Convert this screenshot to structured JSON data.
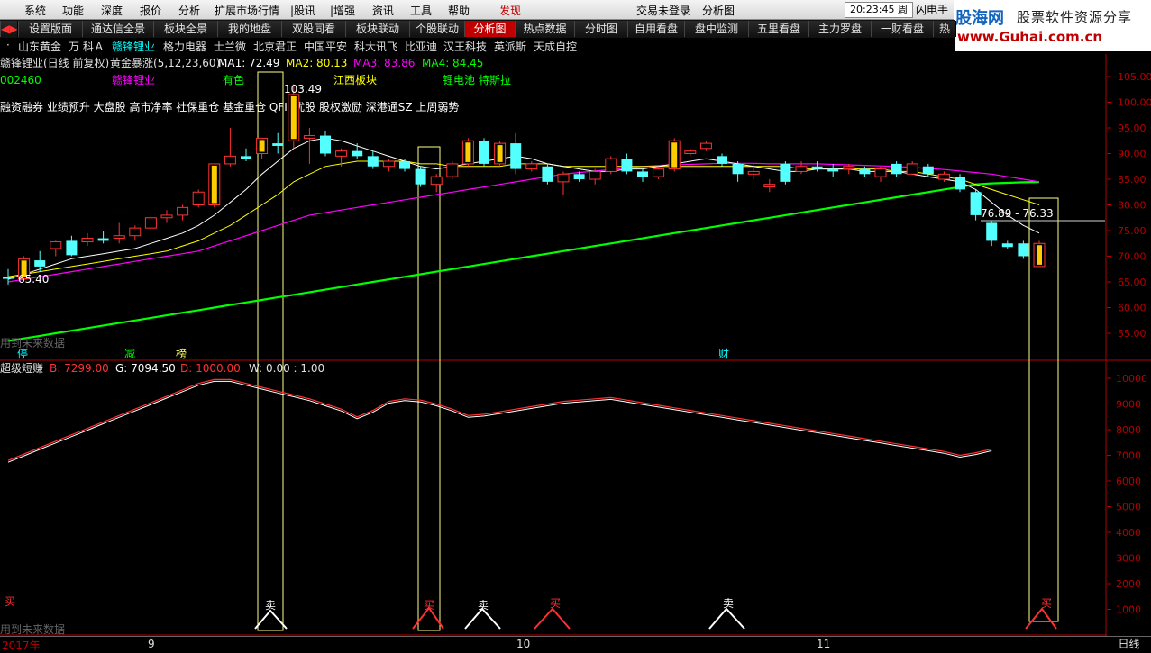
{
  "menu": {
    "items": [
      "系统",
      "功能",
      "深度",
      "报价",
      "分析",
      "扩展市场行情",
      "|股讯",
      "|增强",
      "资讯",
      "工具",
      "帮助",
      "发现"
    ],
    "center": [
      "交易未登录",
      "分析图"
    ],
    "clock": "20:23:45 周一",
    "flash": "闪电手"
  },
  "logo": {
    "line1": "股海网",
    "line2": "股票软件资源分享",
    "line3": "www.Guhai.com.cn"
  },
  "tabs": [
    "设置版面",
    "通达信全景",
    "板块全景",
    "我的地盘",
    "双股同看",
    "板块联动",
    "个股联动",
    "分析图",
    "热点数据",
    "分时图",
    "自用看盘",
    "盘中监测",
    "五里看盘",
    "主力罗盘",
    "一财看盘",
    "热"
  ],
  "active_tab": "分析图",
  "stocks": [
    "山东黄金",
    "万 科Ａ",
    "赣锋锂业",
    "格力电器",
    "士兰微",
    "北京君正",
    "中国平安",
    "科大讯飞",
    "比亚迪",
    "汉王科技",
    "英派斯",
    "天成自控"
  ],
  "active_stock": "赣锋锂业",
  "colors": {
    "up": "#ff3232",
    "down": "#54ffff",
    "ma1": "#ffffff",
    "ma2": "#ffff00",
    "ma3": "#ff00ff",
    "ma4": "#00ff00",
    "bg": "#000000",
    "grid": "#b40000"
  },
  "main": {
    "header": {
      "title": "赣锋锂业(日线 前复权)",
      "indicator": "黄金暴涨(5,12,23,60)",
      "ma1": "MA1: 72.49",
      "ma2": "MA2: 80.13",
      "ma3": "MA3: 83.86",
      "ma4": "MA4: 84.45"
    },
    "code": "002460",
    "name": "赣锋锂业",
    "sector1": "有色",
    "sector2": "江西板块",
    "concept": "锂电池 特斯拉",
    "tags": "融资融券 业绩预升 大盘股 高市净率 社保重仓 基金重仓 QFII 优股 股权激励 深港通SZ 上周弱势",
    "high_label": "103.49",
    "low_label": "65.40",
    "range_label": "76.89 - 76.33",
    "bottom_note": "用到未来数据",
    "markers": [
      "停",
      "减",
      "榜",
      "财"
    ]
  },
  "sub": {
    "header": {
      "name": "超级短赚",
      "b": "B: 7299.00",
      "g": "G: 7094.50",
      "d": "D: 1000.00",
      "w": "W: 0.00 : 1.00"
    },
    "note": "用到未来数据",
    "signal_buy": "买",
    "signal_sell": "卖"
  },
  "axis": {
    "main_ticks": [
      "105.00",
      "100.00",
      "95.00",
      "90.00",
      "85.00",
      "80.00",
      "75.00",
      "70.00",
      "65.00",
      "60.00",
      "55.00"
    ],
    "sub_ticks": [
      "10000",
      "9000",
      "8000",
      "7000",
      "6000",
      "5000",
      "4000",
      "3000",
      "2000",
      "1000"
    ],
    "dates": [
      "2017年",
      "9",
      "10",
      "11"
    ]
  },
  "bottom_tab": "日线",
  "chart_data": {
    "type": "candlestick",
    "candles": [
      {
        "o": 66.0,
        "h": 67.5,
        "l": 64.5,
        "c": 65.6
      },
      {
        "o": 65.6,
        "h": 70.0,
        "l": 65.0,
        "c": 69.5
      },
      {
        "o": 69.2,
        "h": 71.0,
        "l": 67.0,
        "c": 68.0
      },
      {
        "o": 71.5,
        "h": 73.0,
        "l": 70.0,
        "c": 72.8
      },
      {
        "o": 73.0,
        "h": 74.0,
        "l": 70.0,
        "c": 70.2
      },
      {
        "o": 72.8,
        "h": 74.5,
        "l": 72.0,
        "c": 73.5
      },
      {
        "o": 73.5,
        "h": 75.0,
        "l": 72.5,
        "c": 73.0
      },
      {
        "o": 73.5,
        "h": 76.5,
        "l": 72.5,
        "c": 74.0
      },
      {
        "o": 74.0,
        "h": 76.0,
        "l": 73.0,
        "c": 75.5
      },
      {
        "o": 75.5,
        "h": 78.0,
        "l": 75.0,
        "c": 77.5
      },
      {
        "o": 77.5,
        "h": 79.0,
        "l": 76.5,
        "c": 78.0
      },
      {
        "o": 78.0,
        "h": 80.0,
        "l": 77.0,
        "c": 79.5
      },
      {
        "o": 80.0,
        "h": 83.0,
        "l": 79.5,
        "c": 82.5
      },
      {
        "o": 80.0,
        "h": 88.0,
        "l": 79.5,
        "c": 88.0
      },
      {
        "o": 88.0,
        "h": 95.0,
        "l": 87.5,
        "c": 89.5
      },
      {
        "o": 89.5,
        "h": 91.0,
        "l": 88.5,
        "c": 89.0
      },
      {
        "o": 90.0,
        "h": 93.0,
        "l": 89.0,
        "c": 93.0
      },
      {
        "o": 92.0,
        "h": 94.0,
        "l": 90.0,
        "c": 91.5
      },
      {
        "o": 92.5,
        "h": 103.5,
        "l": 91.0,
        "c": 101.5
      },
      {
        "o": 93.0,
        "h": 95.0,
        "l": 88.0,
        "c": 93.5
      },
      {
        "o": 93.5,
        "h": 94.5,
        "l": 89.5,
        "c": 90.0
      },
      {
        "o": 89.5,
        "h": 91.0,
        "l": 87.5,
        "c": 90.5
      },
      {
        "o": 90.5,
        "h": 92.0,
        "l": 89.0,
        "c": 89.5
      },
      {
        "o": 89.5,
        "h": 90.5,
        "l": 87.0,
        "c": 87.5
      },
      {
        "o": 87.5,
        "h": 89.0,
        "l": 86.5,
        "c": 88.5
      },
      {
        "o": 88.5,
        "h": 89.0,
        "l": 86.5,
        "c": 87.0
      },
      {
        "o": 87.0,
        "h": 87.5,
        "l": 83.5,
        "c": 84.0
      },
      {
        "o": 84.0,
        "h": 86.0,
        "l": 82.5,
        "c": 85.5
      },
      {
        "o": 85.5,
        "h": 88.5,
        "l": 85.0,
        "c": 88.0
      },
      {
        "o": 88.0,
        "h": 93.0,
        "l": 87.5,
        "c": 92.5
      },
      {
        "o": 92.5,
        "h": 93.0,
        "l": 87.5,
        "c": 88.0
      },
      {
        "o": 88.0,
        "h": 92.5,
        "l": 87.5,
        "c": 92.0
      },
      {
        "o": 92.0,
        "h": 94.0,
        "l": 86.0,
        "c": 87.0
      },
      {
        "o": 87.0,
        "h": 88.5,
        "l": 86.5,
        "c": 88.0
      },
      {
        "o": 87.5,
        "h": 88.0,
        "l": 84.0,
        "c": 84.5
      },
      {
        "o": 84.5,
        "h": 86.5,
        "l": 82.0,
        "c": 86.0
      },
      {
        "o": 86.0,
        "h": 86.5,
        "l": 84.5,
        "c": 85.0
      },
      {
        "o": 85.0,
        "h": 87.0,
        "l": 84.0,
        "c": 86.5
      },
      {
        "o": 86.5,
        "h": 89.5,
        "l": 86.0,
        "c": 89.0
      },
      {
        "o": 89.0,
        "h": 90.0,
        "l": 86.0,
        "c": 86.5
      },
      {
        "o": 86.5,
        "h": 87.0,
        "l": 84.5,
        "c": 85.5
      },
      {
        "o": 85.5,
        "h": 87.5,
        "l": 85.0,
        "c": 87.0
      },
      {
        "o": 87.0,
        "h": 93.0,
        "l": 86.5,
        "c": 92.5
      },
      {
        "o": 90.0,
        "h": 91.0,
        "l": 89.5,
        "c": 90.5
      },
      {
        "o": 91.0,
        "h": 92.5,
        "l": 90.5,
        "c": 92.0
      },
      {
        "o": 89.5,
        "h": 90.0,
        "l": 87.5,
        "c": 88.0
      },
      {
        "o": 88.0,
        "h": 88.5,
        "l": 84.5,
        "c": 86.0
      },
      {
        "o": 86.0,
        "h": 88.0,
        "l": 85.0,
        "c": 86.5
      },
      {
        "o": 83.5,
        "h": 85.0,
        "l": 82.5,
        "c": 84.0
      },
      {
        "o": 88.0,
        "h": 88.5,
        "l": 84.0,
        "c": 84.5
      },
      {
        "o": 86.5,
        "h": 88.5,
        "l": 86.0,
        "c": 87.5
      },
      {
        "o": 87.5,
        "h": 88.5,
        "l": 86.5,
        "c": 87.0
      },
      {
        "o": 87.0,
        "h": 88.0,
        "l": 85.5,
        "c": 86.5
      },
      {
        "o": 87.0,
        "h": 88.0,
        "l": 86.0,
        "c": 87.5
      },
      {
        "o": 87.0,
        "h": 87.5,
        "l": 85.5,
        "c": 86.0
      },
      {
        "o": 85.5,
        "h": 87.5,
        "l": 84.5,
        "c": 87.0
      },
      {
        "o": 88.0,
        "h": 88.5,
        "l": 85.5,
        "c": 86.0
      },
      {
        "o": 86.0,
        "h": 88.5,
        "l": 86.0,
        "c": 88.0
      },
      {
        "o": 87.5,
        "h": 88.0,
        "l": 85.5,
        "c": 86.0
      },
      {
        "o": 85.0,
        "h": 86.5,
        "l": 84.5,
        "c": 86.0
      },
      {
        "o": 85.5,
        "h": 86.0,
        "l": 82.5,
        "c": 83.0
      },
      {
        "o": 82.5,
        "h": 83.0,
        "l": 77.0,
        "c": 78.0
      },
      {
        "o": 76.5,
        "h": 77.0,
        "l": 72.0,
        "c": 73.0
      },
      {
        "o": 72.5,
        "h": 73.0,
        "l": 71.5,
        "c": 71.8
      },
      {
        "o": 72.5,
        "h": 73.0,
        "l": 69.5,
        "c": 70.0
      },
      {
        "o": 68.0,
        "h": 73.0,
        "l": 68.0,
        "c": 72.5
      }
    ],
    "ma1": [
      65.5,
      66.5,
      67.5,
      68.5,
      69.5,
      70.0,
      70.5,
      71.0,
      71.5,
      72.5,
      73.5,
      74.5,
      76.0,
      78.0,
      80.5,
      83.0,
      86.0,
      88.5,
      91.0,
      92.5,
      93.0,
      92.5,
      91.5,
      90.5,
      89.5,
      88.5,
      87.5,
      87.0,
      87.5,
      88.0,
      88.5,
      89.0,
      89.5,
      89.0,
      88.0,
      87.5,
      87.0,
      86.5,
      86.5,
      87.0,
      87.0,
      87.5,
      88.0,
      88.5,
      89.0,
      88.5,
      88.0,
      87.5,
      87.0,
      86.5,
      86.5,
      87.0,
      87.0,
      87.0,
      86.5,
      86.5,
      86.5,
      86.0,
      85.5,
      85.0,
      84.5,
      83.0,
      80.5,
      78.0,
      76.0,
      74.5
    ],
    "ma2": [
      66.0,
      66.5,
      67.0,
      67.5,
      68.0,
      68.5,
      69.0,
      69.5,
      70.0,
      70.5,
      71.0,
      72.0,
      73.0,
      74.5,
      76.0,
      78.0,
      80.0,
      82.0,
      84.5,
      86.0,
      87.5,
      88.0,
      88.5,
      88.5,
      88.5,
      88.5,
      88.0,
      88.0,
      87.5,
      87.5,
      87.5,
      87.5,
      88.0,
      88.0,
      88.0,
      87.5,
      87.5,
      87.5,
      87.5,
      87.5,
      87.5,
      87.5,
      87.5,
      87.5,
      87.5,
      87.5,
      87.5,
      87.5,
      87.5,
      87.5,
      87.0,
      87.0,
      87.0,
      87.0,
      87.0,
      87.0,
      86.5,
      86.5,
      86.0,
      85.5,
      85.0,
      84.0,
      83.0,
      82.0,
      81.0,
      80.0
    ],
    "ma3": [
      65.0,
      65.5,
      66.0,
      66.5,
      67.0,
      67.5,
      68.0,
      68.5,
      69.0,
      69.5,
      70.0,
      70.5,
      71.0,
      72.0,
      73.0,
      74.0,
      75.0,
      76.0,
      77.0,
      78.0,
      78.5,
      79.0,
      79.5,
      80.0,
      80.5,
      81.0,
      81.5,
      82.0,
      82.5,
      83.0,
      83.5,
      84.0,
      84.5,
      85.0,
      85.5,
      86.0,
      86.3,
      86.6,
      86.9,
      87.2,
      87.5,
      87.7,
      87.8,
      87.9,
      88.0,
      88.1,
      88.1,
      88.1,
      88.0,
      88.0,
      88.0,
      88.0,
      87.9,
      87.8,
      87.7,
      87.6,
      87.5,
      87.3,
      87.1,
      86.9,
      86.6,
      86.3,
      86.0,
      85.5,
      85.0,
      84.5
    ],
    "ma4": [
      53.5,
      54.0,
      54.5,
      55.0,
      55.5,
      56.0,
      56.5,
      57.0,
      57.5,
      58.0,
      58.5,
      59.0,
      59.5,
      60.0,
      60.5,
      61.0,
      61.5,
      62.0,
      62.5,
      63.0,
      63.5,
      64.0,
      64.5,
      65.0,
      65.5,
      66.0,
      66.5,
      67.0,
      67.5,
      68.0,
      68.5,
      69.0,
      69.5,
      70.0,
      70.5,
      71.0,
      71.5,
      72.0,
      72.5,
      73.0,
      73.5,
      74.0,
      74.5,
      75.0,
      75.5,
      76.0,
      76.5,
      77.0,
      77.5,
      78.0,
      78.5,
      79.0,
      79.5,
      80.0,
      80.5,
      81.0,
      81.5,
      82.0,
      82.5,
      83.0,
      83.5,
      84.0,
      84.2,
      84.3,
      84.4,
      84.45
    ],
    "sub_b": [
      6800,
      7050,
      7300,
      7550,
      7800,
      8050,
      8300,
      8550,
      8800,
      9050,
      9300,
      9550,
      9800,
      9950,
      9950,
      9800,
      9650,
      9500,
      9350,
      9200,
      9000,
      8800,
      8500,
      8750,
      9100,
      9200,
      9150,
      9000,
      8800,
      8550,
      8600,
      8700,
      8800,
      8900,
      9000,
      9100,
      9150,
      9200,
      9250,
      9150,
      9050,
      8950,
      8850,
      8750,
      8650,
      8550,
      8450,
      8350,
      8250,
      8150,
      8050,
      7950,
      7850,
      7750,
      7650,
      7550,
      7450,
      7350,
      7250,
      7150,
      7000,
      7100,
      7250
    ]
  }
}
